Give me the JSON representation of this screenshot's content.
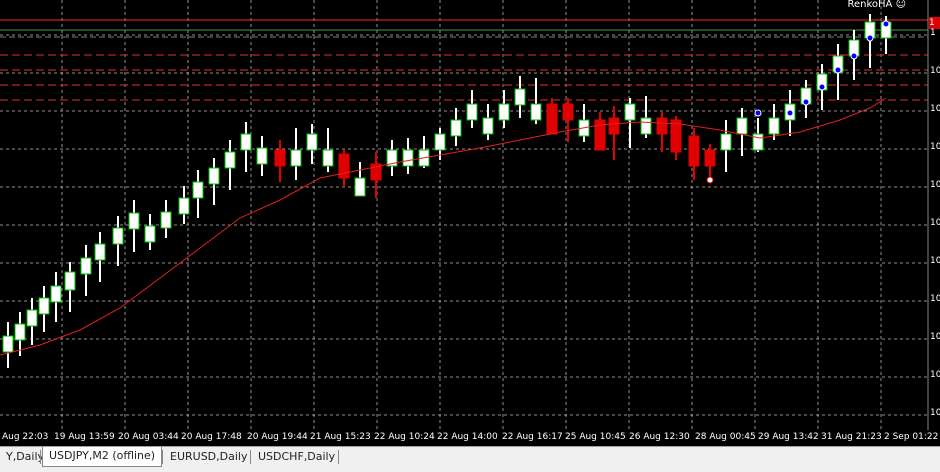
{
  "indicator": {
    "label": "RenkoHA",
    "icon": "smiley-icon"
  },
  "price_marker": {
    "text": "1",
    "color": "#e00000"
  },
  "y_axis": {
    "tick_labels": [
      "1",
      "10",
      "10",
      "10",
      "10",
      "10",
      "10",
      "10",
      "10",
      "10",
      "10"
    ]
  },
  "x_axis": {
    "labels": [
      "Aug 22:03",
      "19 Aug 13:59",
      "20 Aug 03:44",
      "20 Aug 17:48",
      "20 Aug 19:44",
      "21 Aug 15:23",
      "22 Aug 10:24",
      "22 Aug 14:00",
      "22 Aug 16:17",
      "25 Aug 10:45",
      "26 Aug 12:30",
      "28 Aug 00:45",
      "29 Aug 13:42",
      "31 Aug 21:23",
      "2 Sep 01:22"
    ]
  },
  "tabs": [
    {
      "label": "Y,Daily",
      "active": false
    },
    {
      "label": "USDJPY,M2 (offline)",
      "active": true
    },
    {
      "label": "EURUSD,Daily",
      "active": false
    },
    {
      "label": "USDCHF,Daily",
      "active": false
    }
  ],
  "colors": {
    "background": "#000000",
    "grid": "#c0c0c0",
    "bull_body": "#ffffff",
    "bull_outline": "#00c000",
    "bear_body": "#e00000",
    "moving_average": "#e02020",
    "level_lines": "#e03030",
    "green_line": "#40a040",
    "dot_marker": "#0000ff"
  }
}
